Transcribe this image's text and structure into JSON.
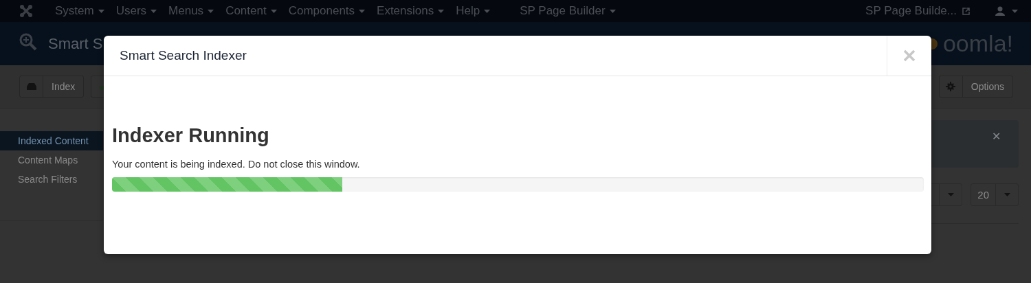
{
  "navbar": {
    "menus": [
      {
        "label": "System"
      },
      {
        "label": "Users"
      },
      {
        "label": "Menus"
      },
      {
        "label": "Content"
      },
      {
        "label": "Components"
      },
      {
        "label": "Extensions"
      },
      {
        "label": "Help"
      },
      {
        "label": "SP Page Builder"
      }
    ],
    "site_link": "SP Page Builde..."
  },
  "header": {
    "title": "Smart S",
    "logo_text": "oomla!"
  },
  "toolbar": {
    "buttons": [
      {
        "kind": "labeled",
        "label": "Index"
      },
      {
        "kind": "split"
      }
    ],
    "right_buttons": [
      {
        "kind": "labeled",
        "label": "Options"
      }
    ]
  },
  "alert": {
    "close": "✕"
  },
  "sidebar": {
    "items": [
      {
        "label": "Indexed Content",
        "selected": true
      },
      {
        "label": "Content Maps",
        "selected": false
      },
      {
        "label": "Search Filters",
        "selected": false
      }
    ]
  },
  "list_controls": [
    {
      "kind": "select"
    },
    {
      "kind": "select",
      "value": "20"
    }
  ],
  "modal": {
    "title": "Smart Search Indexer",
    "heading": "Indexer Running",
    "message": "Your content is being indexed. Do not close this window.",
    "progress": {
      "level": 0.284
    }
  }
}
